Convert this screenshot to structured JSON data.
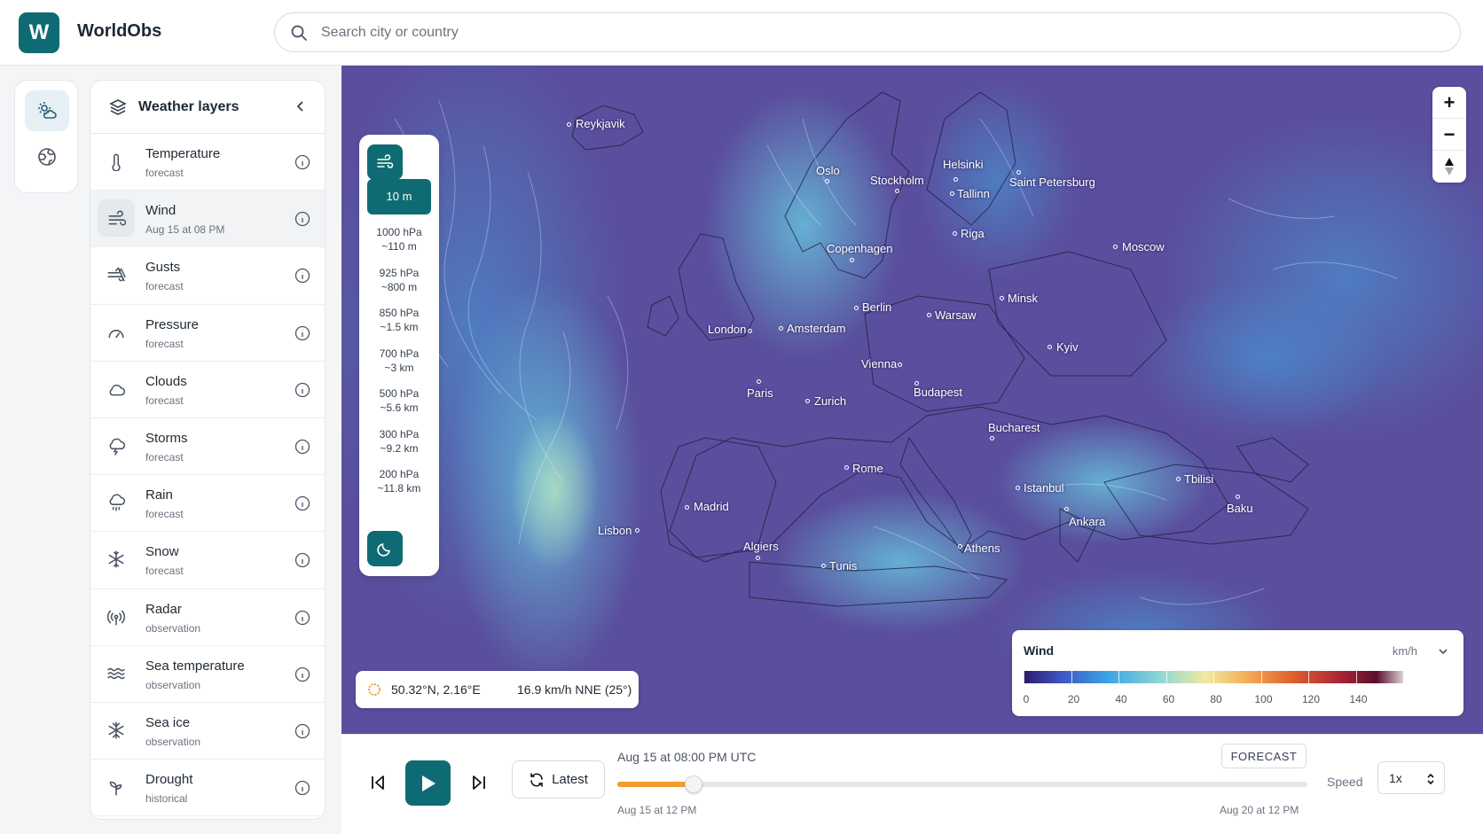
{
  "app": {
    "logo_letter": "W",
    "title": "WorldObs"
  },
  "search": {
    "placeholder": "Search city or country"
  },
  "layers_panel": {
    "title": "Weather layers",
    "items": [
      {
        "name": "Temperature",
        "sub": "forecast",
        "icon": "thermometer-icon"
      },
      {
        "name": "Wind",
        "sub": "Aug 15 at 08 PM",
        "icon": "wind-icon",
        "active": true
      },
      {
        "name": "Gusts",
        "sub": "forecast",
        "icon": "gusts-icon"
      },
      {
        "name": "Pressure",
        "sub": "forecast",
        "icon": "gauge-icon"
      },
      {
        "name": "Clouds",
        "sub": "forecast",
        "icon": "cloud-icon"
      },
      {
        "name": "Storms",
        "sub": "forecast",
        "icon": "storm-icon"
      },
      {
        "name": "Rain",
        "sub": "forecast",
        "icon": "rain-icon"
      },
      {
        "name": "Snow",
        "sub": "forecast",
        "icon": "snowflake-icon"
      },
      {
        "name": "Radar",
        "sub": "observation",
        "icon": "radar-icon"
      },
      {
        "name": "Sea temperature",
        "sub": "observation",
        "icon": "waves-icon"
      },
      {
        "name": "Sea ice",
        "sub": "observation",
        "icon": "sea-ice-icon"
      },
      {
        "name": "Drought",
        "sub": "historical",
        "icon": "sprout-icon"
      }
    ]
  },
  "levels": [
    {
      "line1": "10 m",
      "line2": "",
      "active": true
    },
    {
      "line1": "1000 hPa",
      "line2": "~110 m"
    },
    {
      "line1": "925 hPa",
      "line2": "~800 m"
    },
    {
      "line1": "850 hPa",
      "line2": "~1.5 km"
    },
    {
      "line1": "700 hPa",
      "line2": "~3 km"
    },
    {
      "line1": "500 hPa",
      "line2": "~5.6 km"
    },
    {
      "line1": "300 hPa",
      "line2": "~9.2 km"
    },
    {
      "line1": "200 hPa",
      "line2": "~11.8 km"
    }
  ],
  "cities": {
    "reykjavik": "Reykjavik",
    "oslo": "Oslo",
    "stockholm": "Stockholm",
    "helsinki": "Helsinki",
    "tallinn": "Tallinn",
    "saint_petersburg": "Saint Petersburg",
    "riga": "Riga",
    "moscow": "Moscow",
    "copenhagen": "Copenhagen",
    "minsk": "Minsk",
    "berlin": "Berlin",
    "warsaw": "Warsaw",
    "london": "London",
    "amsterdam": "Amsterdam",
    "kyiv": "Kyiv",
    "vienna": "Vienna",
    "paris": "Paris",
    "budapest": "Budapest",
    "zurich": "Zurich",
    "bucharest": "Bucharest",
    "rome": "Rome",
    "tbilisi": "Tbilisi",
    "istanbul": "Istanbul",
    "madrid": "Madrid",
    "baku": "Baku",
    "ankara": "Ankara",
    "lisbon": "Lisbon",
    "algiers": "Algiers",
    "athens": "Athens",
    "tunis": "Tunis"
  },
  "readout": {
    "coords": "50.32°N, 2.16°E",
    "wind": "16.9 km/h NNE (25°)"
  },
  "legend": {
    "title": "Wind",
    "unit": "km/h",
    "ticks": [
      "0",
      "20",
      "40",
      "60",
      "80",
      "100",
      "120",
      "140"
    ],
    "scale_min": 0,
    "scale_max": 160
  },
  "timeline": {
    "current": "Aug 15 at 08:00 PM UTC",
    "mode": "FORECAST",
    "start": "Aug 15 at 12 PM",
    "end": "Aug 20 at 12 PM",
    "progress_fraction": 0.11,
    "latest_label": "Latest",
    "speed_label": "Speed",
    "speed_value": "1x"
  },
  "colors": {
    "brand": "#0f6b73",
    "progress": "#f39b2b"
  }
}
